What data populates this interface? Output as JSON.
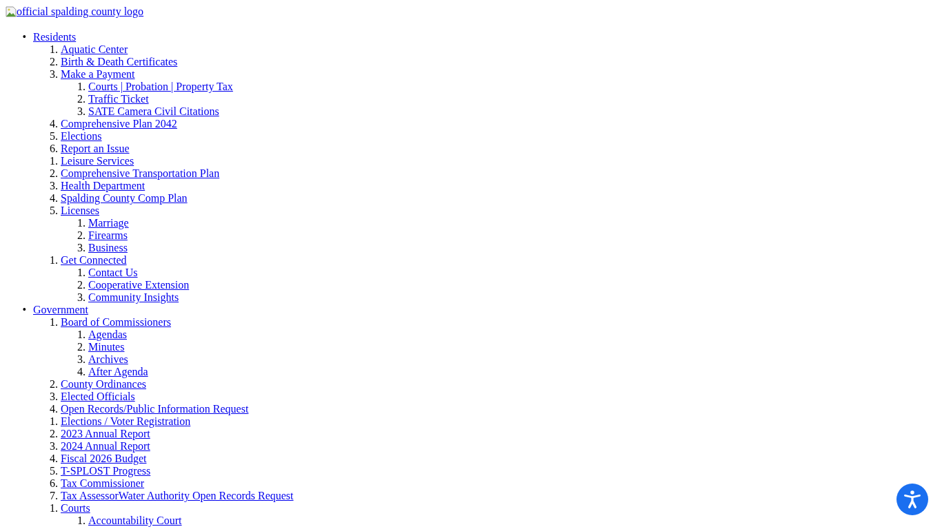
{
  "logo": {
    "alt_text": "official spalding county logo"
  },
  "nav": [
    {
      "marker": "•",
      "label": "Residents",
      "children": [
        {
          "marker": "1.",
          "label": "Aquatic Center"
        },
        {
          "marker": "2.",
          "label": "Birth & Death Certificates"
        },
        {
          "marker": "3.",
          "label": "Make a Payment",
          "children": [
            {
              "marker": "1.",
              "label": "Courts | Probation | Property Tax"
            },
            {
              "marker": "2.",
              "label": "Traffic Ticket"
            },
            {
              "marker": "3.",
              "label": "SATE Camera Civil Citations"
            }
          ]
        },
        {
          "marker": "4.",
          "label": "Comprehensive Plan 2042"
        },
        {
          "marker": "5.",
          "label": "Elections"
        },
        {
          "marker": "6.",
          "label": "Report an Issue"
        },
        {
          "marker": "1.",
          "label": "Leisure Services"
        },
        {
          "marker": "2.",
          "label": "Comprehensive Transportation Plan"
        },
        {
          "marker": "3.",
          "label": "Health Department"
        },
        {
          "marker": "4.",
          "label": "Spalding County Comp Plan"
        },
        {
          "marker": "5.",
          "label": "Licenses",
          "children": [
            {
              "marker": "1.",
              "label": "Marriage"
            },
            {
              "marker": "2.",
              "label": "Firearms"
            },
            {
              "marker": "3.",
              "label": "Business"
            }
          ]
        },
        {
          "marker": "1.",
          "label": "Get Connected",
          "children": [
            {
              "marker": "1.",
              "label": "Contact Us"
            },
            {
              "marker": "2.",
              "label": "Cooperative Extension"
            },
            {
              "marker": "3.",
              "label": "Community Insights"
            }
          ]
        }
      ]
    },
    {
      "marker": "•",
      "label": "Government",
      "children": [
        {
          "marker": "1.",
          "label": "Board of Commissioners",
          "children": [
            {
              "marker": "1.",
              "label": "Agendas"
            },
            {
              "marker": "2.",
              "label": "Minutes"
            },
            {
              "marker": "3.",
              "label": "Archives"
            },
            {
              "marker": "4.",
              "label": "After Agenda"
            }
          ]
        },
        {
          "marker": "2.",
          "label": "County Ordinances"
        },
        {
          "marker": "3.",
          "label": "Elected Officials"
        },
        {
          "marker": "4.",
          "label": "Open Records/Public Information Request"
        },
        {
          "marker": "1.",
          "label": "Elections / Voter Registration"
        },
        {
          "marker": "2.",
          "label": "2023 Annual Report"
        },
        {
          "marker": "3.",
          "label": "2024 Annual Report"
        },
        {
          "marker": "4.",
          "label": "Fiscal 2026 Budget"
        },
        {
          "marker": "5.",
          "label": "T-SPLOST Progress"
        },
        {
          "marker": "6.",
          "label": "Tax Commissioner"
        },
        {
          "marker": "7.",
          "label": "Tax AssessorWater Authority Open Records Request"
        },
        {
          "marker": "1.",
          "label": "Courts",
          "children": [
            {
              "marker": "1.",
              "label": "Accountability Court"
            }
          ]
        }
      ]
    }
  ],
  "accessibility_button": {
    "kind": "accessibility"
  }
}
